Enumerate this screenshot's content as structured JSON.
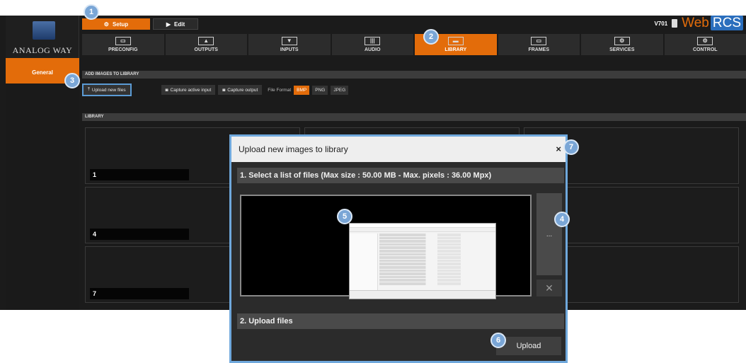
{
  "header": {
    "logo_text": "ANALOG WAY",
    "setup_label": "Setup",
    "edit_label": "Edit",
    "version": "V701",
    "brand_web": "Web",
    "brand_rcs": "RCS"
  },
  "menu": {
    "tabs": [
      {
        "label": "PRECONFIG",
        "icon": "▭"
      },
      {
        "label": "OUTPUTS",
        "icon": "▲"
      },
      {
        "label": "INPUTS",
        "icon": "▼"
      },
      {
        "label": "AUDIO",
        "icon": "|||"
      },
      {
        "label": "LIBRARY",
        "icon": "▬"
      },
      {
        "label": "FRAMES",
        "icon": "▭"
      },
      {
        "label": "SERVICES",
        "icon": "⚙"
      },
      {
        "label": "CONTROL",
        "icon": "⚙"
      }
    ],
    "active": "LIBRARY"
  },
  "sidebar": {
    "items": [
      {
        "label": "General"
      }
    ]
  },
  "content": {
    "add_section": "ADD IMAGES TO LIBRARY",
    "upload_new": "Upload new files",
    "capture_input": "Capture active input",
    "capture_output": "Capture output",
    "file_format_label": "File Format",
    "formats": [
      "BMP",
      "PNG",
      "JPEG"
    ],
    "active_format": "BMP",
    "library_section": "LIBRARY",
    "slots": [
      "1",
      "4",
      "7"
    ]
  },
  "modal": {
    "title": "Upload new images to library",
    "close": "×",
    "step1": "1. Select a list of files (Max size : 50.00 MB - Max. pixels : 36.00 Mpx)",
    "browse": "...",
    "clear": "✕",
    "step2": "2. Upload files",
    "upload": "Upload"
  },
  "callouts": [
    "1",
    "2",
    "3",
    "4",
    "5",
    "6",
    "7"
  ],
  "colors": {
    "accent": "#e36c0a",
    "callout": "#7aa6d6",
    "highlight": "#6fa8dc"
  }
}
